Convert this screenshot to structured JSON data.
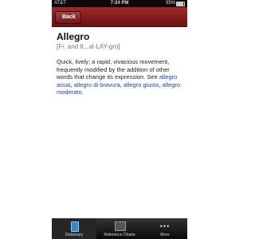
{
  "status_bar": {
    "carrier": "AT&T",
    "time": "7:24 PM",
    "battery": "95%"
  },
  "nav": {
    "back_label": "Back"
  },
  "entry": {
    "headword": "Allegro",
    "pronunciation": "[Fr. and It., al-LAY-gro]",
    "definition_text": "Quick, lively; a rapid, vivacious movement, frequently modified by the addition of other words that change its expression. See ",
    "see_also": [
      "allegro assai",
      "allegro di bravura",
      "allegro giusto",
      "allegro moderato"
    ],
    "separator": ", ",
    "period": "."
  },
  "tab_bar": {
    "tabs": [
      {
        "label": "Dictionary",
        "icon": "book-icon",
        "active": true
      },
      {
        "label": "Reference Charts",
        "icon": "chart-icon",
        "active": false
      },
      {
        "label": "More",
        "icon": "more-icon",
        "active": false
      }
    ]
  }
}
